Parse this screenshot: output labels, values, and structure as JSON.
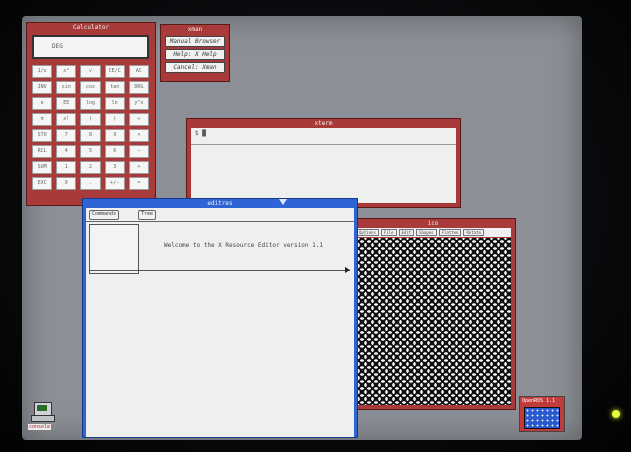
{
  "windows": {
    "calculator": {
      "title": "Calculator",
      "display": "DEG",
      "keys": [
        "1/x",
        "x²",
        "√",
        "CE/C",
        "AC",
        "INV",
        "sin",
        "cos",
        "tan",
        "DRG",
        "e",
        "EE",
        "log",
        "ln",
        "y^x",
        "π",
        "x!",
        "(",
        ")",
        "÷",
        "STO",
        "7",
        "8",
        "9",
        "×",
        "RCL",
        "4",
        "5",
        "6",
        "−",
        "SUM",
        "1",
        "2",
        "3",
        "+",
        "EXC",
        "0",
        ".",
        "+/-",
        "="
      ]
    },
    "xman": {
      "title": "xman",
      "buttons": [
        "Manual Browser",
        "Help: X Help",
        "Cancel: Xman"
      ]
    },
    "xterm": {
      "title": "xterm",
      "prompt": "$ █"
    },
    "pattern": {
      "title": "ico",
      "menu": [
        "Options",
        "File",
        "Edit",
        "Shapes",
        "Flatten",
        "Rotate"
      ]
    },
    "editres": {
      "title": "editres",
      "tabs": [
        "Commands",
        "Tree"
      ],
      "welcome": "Welcome to the X Resource Editor version 1.1"
    }
  },
  "icons": {
    "console": "console",
    "appmenu": "OpenROS 1.1"
  }
}
